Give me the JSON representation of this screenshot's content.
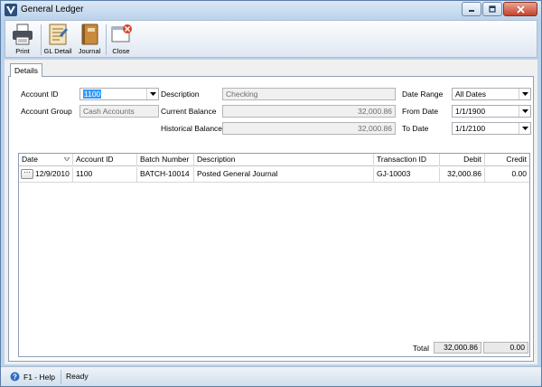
{
  "window": {
    "title": "General Ledger"
  },
  "toolbar": {
    "buttons": [
      {
        "label": "Print"
      },
      {
        "label": "GL Detail"
      },
      {
        "label": "Journal"
      },
      {
        "label": "Close"
      }
    ]
  },
  "tabs": [
    {
      "label": "Details"
    }
  ],
  "form": {
    "account_id": {
      "label": "Account ID",
      "value": "1100"
    },
    "account_group": {
      "label": "Account Group",
      "value": "Cash Accounts"
    },
    "description": {
      "label": "Description",
      "value": "Checking"
    },
    "current_balance": {
      "label": "Current Balance",
      "value": "32,000.86"
    },
    "historical_balance": {
      "label": "Historical Balance",
      "value": "32,000.86"
    },
    "date_range": {
      "label": "Date Range",
      "value": "All Dates"
    },
    "from_date": {
      "label": "From Date",
      "value": "1/1/1900"
    },
    "to_date": {
      "label": "To Date",
      "value": "1/1/2100"
    }
  },
  "grid": {
    "columns": [
      "Date",
      "Account ID",
      "Batch Number",
      "Description",
      "Transaction ID",
      "Debit",
      "Credit"
    ],
    "rows": [
      {
        "date": "12/9/2010",
        "account_id": "1100",
        "batch": "BATCH-10014",
        "description": "Posted General Journal",
        "transaction_id": "GJ-10003",
        "debit": "32,000.86",
        "credit": "0.00"
      }
    ],
    "total_label": "Total",
    "total_debit": "32,000.86",
    "total_credit": "0.00"
  },
  "status": {
    "help": "F1 - Help",
    "text": "Ready"
  },
  "colors": {
    "titlebar": "#bcd3ea",
    "accent": "#3399ff",
    "close_button": "#c4432b"
  }
}
